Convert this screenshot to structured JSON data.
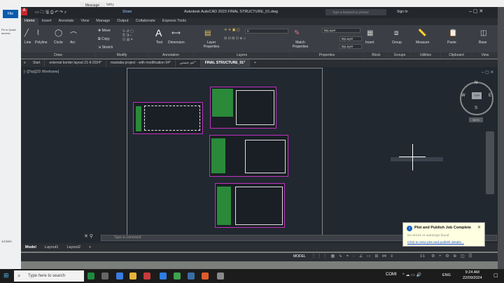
{
  "window": {
    "title": "Autodesk AutoCAD 2023   FINAL STRUCTURE_01.dwg",
    "file_tab": "File",
    "search_placeholder": "Type a keyword or phrase",
    "sign_in": "Sign In",
    "share": "Share",
    "message_tooltip": "Message",
    "user_hint": "fathy"
  },
  "ribbon_tabs": [
    "Home",
    "Insert",
    "Annotate",
    "View",
    "Manage",
    "Output",
    "Collaborate",
    "Express Tools"
  ],
  "ribbon": {
    "draw": {
      "label": "Draw",
      "line": "Line",
      "polyline": "Polyline",
      "circle": "Circle",
      "arc": "Arc"
    },
    "modify": {
      "label": "Modify",
      "move": "Move",
      "copy": "Copy",
      "stretch": "Stretch"
    },
    "annotation": {
      "label": "Annotation",
      "text": "Text",
      "dimension": "Dimension"
    },
    "layers": {
      "label": "Layers",
      "layer_properties": "Layer Properties",
      "current_layer": "0"
    },
    "properties": {
      "label": "Properties",
      "match": "Match Properties",
      "bylayer1": "ByLayer",
      "bylayer2": "ByLayer",
      "bylayer3": "ByLayer"
    },
    "block": {
      "label": "Block",
      "insert": "Insert"
    },
    "groups": {
      "label": "Groups",
      "group": "Group"
    },
    "utilities": {
      "label": "Utilities",
      "measure": "Measure"
    },
    "clipboard": {
      "label": "Clipboard",
      "paste": "Paste"
    },
    "view": {
      "label": "View",
      "base": "Base"
    }
  },
  "doc_tabs": [
    "Start",
    "external border layout 21-9-2024*",
    "mastaba project - with modification 04*",
    "عم حسني*",
    "FINAL STRUCTURE_01*"
  ],
  "viewport_label": "[−][Top][2D Wireframe]",
  "compass": {
    "n": "N",
    "s": "S",
    "e": "E",
    "w": "W",
    "top": "TOP",
    "wcs": "WCS"
  },
  "command_placeholder": "Type a command",
  "layout_tabs": [
    "Model",
    "Layout1",
    "Layout2",
    "+"
  ],
  "status": {
    "model": "MODEL",
    "scale": "1:1"
  },
  "notification": {
    "title": "Plot and Publish Job Complete",
    "subtitle": "No errors or warnings found",
    "link": "Click to view plot and publish details..."
  },
  "left_panel": {
    "items": [
      "Pe to Quick access",
      "14 item"
    ]
  },
  "taskbar": {
    "search": "Type here to search",
    "weather": "COMI",
    "lang": "ENG",
    "time": "9:24 AM",
    "date": "22/09/2024"
  }
}
